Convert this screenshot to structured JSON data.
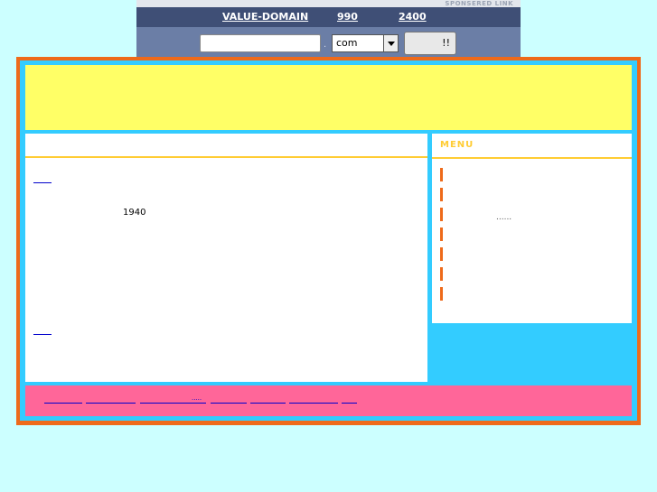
{
  "ad": {
    "sponsored_label": "SPONSERED LINK",
    "brand_link": "VALUE-DOMAIN",
    "price_1": "990",
    "price_2": "2400",
    "domain_input_value": "",
    "dot": ".",
    "tld_selected": "com",
    "go_label": "!!"
  },
  "content": {
    "year": "1940"
  },
  "sidebar": {
    "menu_title": "MENU",
    "ellipsis": "......"
  },
  "footer": {
    "dots": "....."
  },
  "colors": {
    "background": "#ccffff",
    "frame": "#ee6a1a",
    "inner": "#33ccff",
    "header": "#ffff66",
    "footer": "#ff6699",
    "accent_line": "#ffcc33",
    "link": "#0000cc"
  }
}
